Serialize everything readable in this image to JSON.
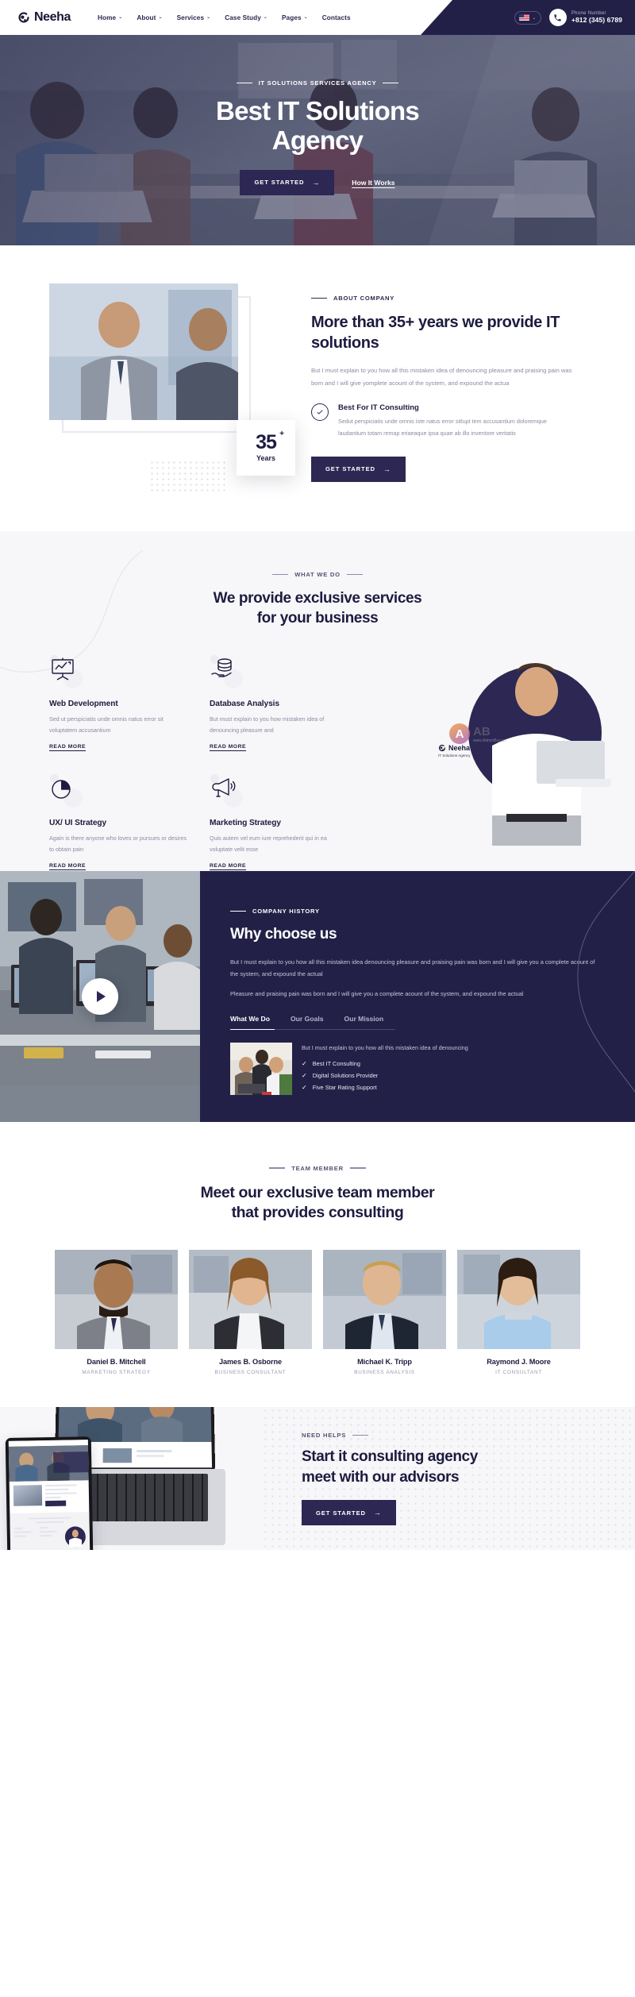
{
  "brand": {
    "name": "Neeha",
    "tagline": "IT Solutions Agency",
    "logo_icon": "neeha-logo-icon"
  },
  "colors": {
    "navy": "#232048",
    "navy_deep": "#2c2853",
    "bg_grey": "#f7f7f9",
    "muted": "#8c8aa3",
    "white": "#ffffff"
  },
  "header": {
    "nav": [
      {
        "label": "Home",
        "has_dropdown": true
      },
      {
        "label": "About",
        "has_dropdown": true
      },
      {
        "label": "Services",
        "has_dropdown": true
      },
      {
        "label": "Case Study",
        "has_dropdown": true
      },
      {
        "label": "Pages",
        "has_dropdown": true
      },
      {
        "label": "Contacts",
        "has_dropdown": false
      }
    ],
    "caret": "⌄",
    "language": {
      "flag": "us-flag-icon",
      "caret": "⌄"
    },
    "phone": {
      "icon": "phone-icon",
      "label": "Phone Number",
      "number": "+812 (345) 6789"
    }
  },
  "hero": {
    "eyebrow": "IT Solutions Services Agency",
    "title_line1": "Best IT Solutions",
    "title_line2": "Agency",
    "primary_button": "GET STARTED",
    "arrow": "→",
    "secondary_link": "How It Works"
  },
  "about": {
    "eyebrow": "ABOUT COMPANY",
    "heading": "More than 35+ years we provide IT solutions",
    "paragraph": "But I must explain to you how all this mistaken idea of denouncing pleasure and praising pain was born and I will give yomplete acount of the system, and expound the actua",
    "badge": {
      "number": "35",
      "plus": "+",
      "label": "Years"
    },
    "feature": {
      "icon": "check-circle-icon",
      "title": "Best For IT Consulting",
      "text": "Sedut perspiciatis unde omnis iste natus error sitlupt tem accusantium doloremque laudantium totam remap eriaeaque ipsa quae ab illo inventore veritatis"
    },
    "button": "GET STARTED",
    "arrow": "→"
  },
  "services": {
    "eyebrow": "WHAT WE DO",
    "heading_line1": "We provide exclusive services",
    "heading_line2": "for your business",
    "read_more": "READ MORE",
    "items": [
      {
        "icon": "presentation-chart-icon",
        "title": "Web Development",
        "text": "Sed ut perspiciatis unde omnis natus error sit voluptatem accusantium"
      },
      {
        "icon": "database-hand-icon",
        "title": "Database Analysis",
        "text": "But must explain to you how mistaken idea of denouncing pleasure and"
      },
      {
        "icon": "pie-chart-icon",
        "title": "UX/ UI Strategy",
        "text": "Again is there anyone who loves or pursues or desires to obtain pain"
      },
      {
        "icon": "megaphone-icon",
        "title": "Marketing Strategy",
        "text": "Quis autem vel eum iure reprehederit qui in ea voluptate velit esse"
      }
    ],
    "laptop_logo": {
      "name": "Neeha",
      "tagline": "IT Solutions Agency"
    },
    "watermark": {
      "letters": "AB",
      "site": "www.AdminBuy.cn"
    }
  },
  "why": {
    "play_button": "play-button-icon",
    "eyebrow": "COMPANY HISTORY",
    "heading": "Why choose us",
    "paragraph1": "But I must explain to you how all this mistaken idea denouncing pleasure and praising pain was born and I will give you a complete acount of the system, and expound the actual",
    "paragraph2": "Pleasure and praising pain was born and I will give you a complete acount of the system, and expound the actual",
    "tabs": [
      {
        "label": "What We Do",
        "active": true
      },
      {
        "label": "Our Goals",
        "active": false
      },
      {
        "label": "Our Mission",
        "active": false
      }
    ],
    "card_text": "But I must explain to you how all this mistaken idea of denouncing",
    "checklist": [
      "Best IT Consulting",
      "Digital Solutions Provider",
      "Five Star Rating Support"
    ],
    "tick": "✓"
  },
  "team": {
    "eyebrow": "TEAM MEMBER",
    "heading_line1": "Meet our exclusive team member",
    "heading_line2": "that provides consulting",
    "members": [
      {
        "name": "Daniel B. Mitchell",
        "role": "MARKETING STRATEGY"
      },
      {
        "name": "James B. Osborne",
        "role": "BUSINESS CONSULTANT"
      },
      {
        "name": "Michael K. Tripp",
        "role": "BUSINESS ANALYSIS"
      },
      {
        "name": "Raymond J. Moore",
        "role": "IT CONSULTANT"
      }
    ]
  },
  "cta": {
    "eyebrow": "NEED HELPS",
    "heading_line1": "Start it consulting agency",
    "heading_line2": "meet with our advisors",
    "button": "GET STARTED",
    "arrow": "→"
  }
}
